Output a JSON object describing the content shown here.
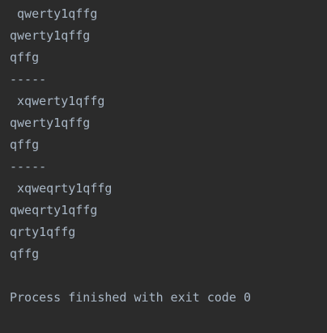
{
  "console": {
    "lines": [
      " qwerty1qffg",
      "qwerty1qffg",
      "qffg",
      "-----",
      " xqwerty1qffg",
      "qwerty1qffg",
      "qffg",
      "-----",
      " xqweqrty1qffg",
      "qweqrty1qffg",
      "qrty1qffg",
      "qffg"
    ],
    "process_message": "Process finished with exit code 0"
  }
}
